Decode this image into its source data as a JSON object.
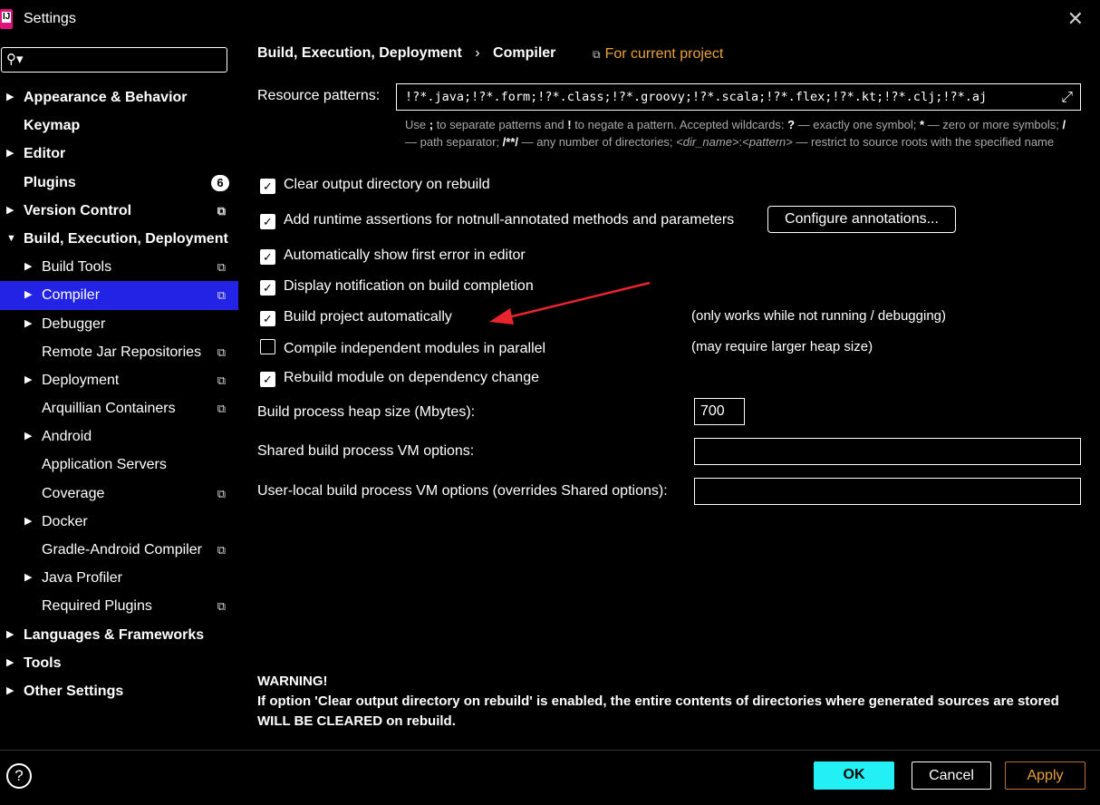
{
  "window": {
    "title": "Settings"
  },
  "search": {
    "placeholder": ""
  },
  "sidebar": {
    "items": [
      {
        "label": "Appearance & Behavior",
        "level": 0,
        "bold": true,
        "arrow": "right",
        "icon": null,
        "badge": null
      },
      {
        "label": "Keymap",
        "level": 0,
        "bold": true,
        "arrow": null,
        "icon": null,
        "badge": null
      },
      {
        "label": "Editor",
        "level": 0,
        "bold": true,
        "arrow": "right",
        "icon": null,
        "badge": null
      },
      {
        "label": "Plugins",
        "level": 0,
        "bold": true,
        "arrow": null,
        "icon": null,
        "badge": "6"
      },
      {
        "label": "Version Control",
        "level": 0,
        "bold": true,
        "arrow": "right",
        "icon": "copy-icon",
        "badge": null
      },
      {
        "label": "Build, Execution, Deployment",
        "level": 0,
        "bold": true,
        "arrow": "down",
        "icon": null,
        "badge": null
      },
      {
        "label": "Build Tools",
        "level": 1,
        "bold": false,
        "arrow": "right",
        "icon": "copy-icon",
        "badge": null
      },
      {
        "label": "Compiler",
        "level": 1,
        "bold": false,
        "arrow": "right",
        "icon": "copy-icon",
        "badge": null,
        "selected": true
      },
      {
        "label": "Debugger",
        "level": 1,
        "bold": false,
        "arrow": "right",
        "icon": null,
        "badge": null
      },
      {
        "label": "Remote Jar Repositories",
        "level": 1,
        "bold": false,
        "arrow": null,
        "icon": "copy-icon",
        "badge": null
      },
      {
        "label": "Deployment",
        "level": 1,
        "bold": false,
        "arrow": "right",
        "icon": "copy-icon",
        "badge": null
      },
      {
        "label": "Arquillian Containers",
        "level": 1,
        "bold": false,
        "arrow": null,
        "icon": "copy-icon",
        "badge": null
      },
      {
        "label": "Android",
        "level": 1,
        "bold": false,
        "arrow": "right",
        "icon": null,
        "badge": null
      },
      {
        "label": "Application Servers",
        "level": 1,
        "bold": false,
        "arrow": null,
        "icon": null,
        "badge": null
      },
      {
        "label": "Coverage",
        "level": 1,
        "bold": false,
        "arrow": null,
        "icon": "copy-icon",
        "badge": null
      },
      {
        "label": "Docker",
        "level": 1,
        "bold": false,
        "arrow": "right",
        "icon": null,
        "badge": null
      },
      {
        "label": "Gradle-Android Compiler",
        "level": 1,
        "bold": false,
        "arrow": null,
        "icon": "copy-icon",
        "badge": null
      },
      {
        "label": "Java Profiler",
        "level": 1,
        "bold": false,
        "arrow": "right",
        "icon": null,
        "badge": null
      },
      {
        "label": "Required Plugins",
        "level": 1,
        "bold": false,
        "arrow": null,
        "icon": "copy-icon",
        "badge": null
      },
      {
        "label": "Languages & Frameworks",
        "level": 0,
        "bold": true,
        "arrow": "right",
        "icon": null,
        "badge": null
      },
      {
        "label": "Tools",
        "level": 0,
        "bold": true,
        "arrow": "right",
        "icon": null,
        "badge": null
      },
      {
        "label": "Other Settings",
        "level": 0,
        "bold": true,
        "arrow": "right",
        "icon": null,
        "badge": null
      }
    ]
  },
  "header": {
    "breadcrumb_parent": "Build, Execution, Deployment",
    "breadcrumb_sep": "›",
    "breadcrumb_current": "Compiler",
    "scope_label": "For current project"
  },
  "resource_patterns": {
    "label": "Resource patterns:",
    "value": "!?*.java;!?*.form;!?*.class;!?*.groovy;!?*.scala;!?*.flex;!?*.kt;!?*.clj;!?*.aj",
    "hint": {
      "p1": "Use ",
      "b1": ";",
      "p2": " to separate patterns and ",
      "b2": "!",
      "p3": " to negate a pattern. Accepted wildcards: ",
      "b3": "?",
      "p4": " — exactly one symbol; ",
      "b4": "*",
      "p5": " — zero or more symbols; ",
      "b5": "/",
      "p6": " — path separator; ",
      "b6": "/**/",
      "p7": " — any number of directories; ",
      "i1": "<dir_name>",
      "p8": ":",
      "i2": "<pattern>",
      "p9": " — restrict to source roots with the specified name"
    }
  },
  "options": {
    "clear_output": {
      "label": "Clear output directory on rebuild",
      "checked": true
    },
    "runtime_assertions": {
      "label": "Add runtime assertions for notnull-annotated methods and parameters",
      "checked": true
    },
    "configure_annotations": "Configure annotations...",
    "show_first_error": {
      "label": "Automatically show first error in editor",
      "checked": true
    },
    "display_notification": {
      "label": "Display notification on build completion",
      "checked": true
    },
    "build_automatically": {
      "label": "Build project automatically",
      "checked": true,
      "note": "(only works while not running / debugging)"
    },
    "compile_parallel": {
      "label": "Compile independent modules in parallel",
      "checked": false,
      "note": "(may require larger heap size)"
    },
    "rebuild_on_dependency": {
      "label": "Rebuild module on dependency change",
      "checked": true
    }
  },
  "heap": {
    "label": "Build process heap size (Mbytes):",
    "value": "700"
  },
  "shared_vm": {
    "label": "Shared build process VM options:",
    "value": ""
  },
  "user_vm": {
    "label": "User-local build process VM options (overrides Shared options):",
    "value": ""
  },
  "warning": {
    "title": "WARNING!",
    "body": "If option 'Clear output directory on rebuild' is enabled, the entire contents of directories where generated sources are stored WILL BE CLEARED on rebuild."
  },
  "footer": {
    "help": "?",
    "ok": "OK",
    "cancel": "Cancel",
    "apply": "Apply"
  },
  "colors": {
    "selection": "#2323e6",
    "accent_orange": "#e8a13a",
    "ok_button": "#22f0f5",
    "annotation_arrow": "#e8242c"
  }
}
